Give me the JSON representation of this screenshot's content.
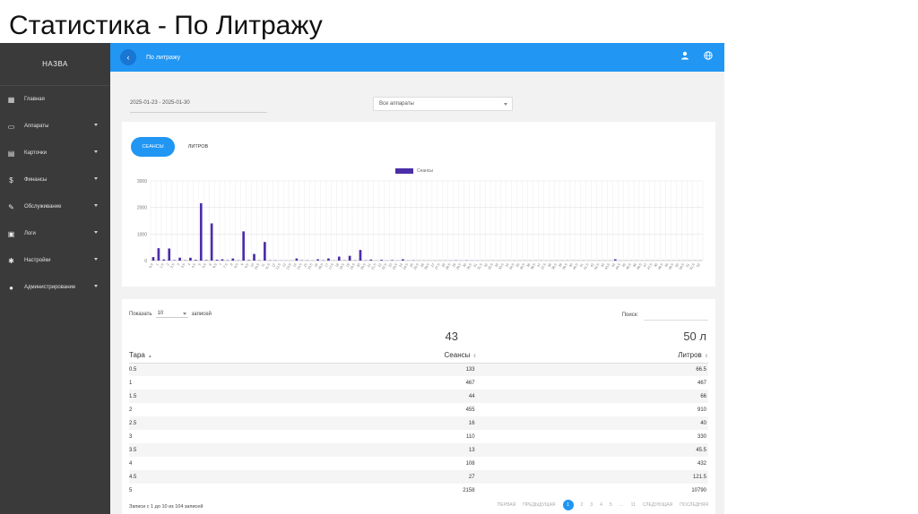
{
  "slide_title": "Статистика - По Литражу",
  "sidebar": {
    "brand": "НАЗВА",
    "items": [
      {
        "label": "Главная",
        "icon": "dashboard-icon",
        "caret": false
      },
      {
        "label": "Аппараты",
        "icon": "devices-icon",
        "caret": true
      },
      {
        "label": "Карточки",
        "icon": "card-icon",
        "caret": true
      },
      {
        "label": "Финансы",
        "icon": "money-icon",
        "caret": true
      },
      {
        "label": "Обслуживание",
        "icon": "wrench-icon",
        "caret": true
      },
      {
        "label": "Логи",
        "icon": "log-icon",
        "caret": true
      },
      {
        "label": "Настройки",
        "icon": "gear-icon",
        "caret": true
      },
      {
        "label": "Администрирование",
        "icon": "person-icon",
        "caret": true
      }
    ]
  },
  "topbar": {
    "title": "По литражу",
    "back_icon": "chevron-left-icon",
    "icons": [
      "user-icon",
      "globe-icon"
    ],
    "color": "#2196f3"
  },
  "filters": {
    "date_range": "2025-01-23 - 2025-01-30",
    "device_select": "Все аппараты"
  },
  "tabs": {
    "sessions": "СЕАНСЫ",
    "liters": "ЛИТРОВ"
  },
  "chart_data": {
    "type": "bar",
    "legend": [
      "Сеансы"
    ],
    "bar_color": "#4b2ea8",
    "ylim": [
      0,
      3000
    ],
    "yticks": [
      "0",
      "1000",
      "2000",
      "3000"
    ],
    "grid": true,
    "categories": [
      "0.5",
      "1",
      "1.5",
      "2",
      "2.5",
      "3",
      "3.5",
      "4",
      "4.5",
      "5",
      "5.5",
      "6",
      "6.5",
      "7",
      "7.5",
      "8",
      "8.5",
      "9",
      "9.5",
      "10",
      "10.5",
      "11",
      "11.5",
      "12",
      "12.5",
      "13",
      "13.5",
      "14",
      "14.5",
      "15",
      "15.5",
      "16",
      "16.5",
      "17",
      "17.5",
      "18",
      "18.5",
      "19",
      "19.5",
      "20",
      "20.5",
      "21",
      "21.5",
      "22",
      "22.5",
      "23",
      "23.5",
      "24",
      "24.5",
      "25",
      "25.5",
      "26",
      "26.5",
      "27",
      "27.5",
      "28",
      "28.5",
      "29",
      "29.5",
      "30",
      "30.5",
      "31",
      "31.5",
      "32",
      "32.5",
      "33",
      "33.5",
      "34",
      "34.5",
      "35",
      "35.5",
      "36",
      "36.5",
      "37",
      "37.5",
      "38",
      "38.5",
      "39",
      "39.5",
      "40",
      "40.5",
      "41",
      "41.5",
      "42",
      "42.5",
      "43",
      "43.5",
      "44",
      "44.5",
      "45",
      "45.5",
      "46",
      "46.5",
      "47",
      "47.5",
      "48",
      "48.5",
      "49",
      "49.5",
      "50",
      "50.5",
      "51",
      "51.5",
      "52"
    ],
    "values": [
      133,
      467,
      44,
      455,
      16,
      110,
      13,
      108,
      27,
      2158,
      20,
      1400,
      30,
      50,
      15,
      80,
      10,
      1100,
      20,
      250,
      10,
      700,
      10,
      10,
      5,
      5,
      5,
      80,
      10,
      10,
      5,
      50,
      10,
      80,
      5,
      150,
      10,
      180,
      10,
      400,
      10,
      40,
      5,
      30,
      5,
      20,
      5,
      50,
      5,
      10,
      5,
      5,
      5,
      5,
      5,
      5,
      5,
      10,
      5,
      10,
      5,
      5,
      5,
      5,
      5,
      5,
      5,
      5,
      5,
      5,
      5,
      5,
      5,
      5,
      5,
      5,
      5,
      5,
      5,
      5,
      5,
      5,
      5,
      5,
      5,
      5,
      5,
      50,
      5,
      5,
      5,
      5,
      5,
      5,
      5,
      5,
      5,
      5,
      5,
      5,
      5,
      5,
      5,
      5
    ]
  },
  "table": {
    "show_label": "Показать",
    "show_value": "10",
    "show_suffix": "записей",
    "search_label": "Поиск:",
    "search_value": "",
    "total_sessions": "43",
    "total_liters": "50 л",
    "headers": {
      "tara": "Тара",
      "sessions": "Сеансы",
      "liters": "Литров"
    },
    "rows": [
      {
        "tara": "0.5",
        "sessions": "133",
        "liters": "66.5"
      },
      {
        "tara": "1",
        "sessions": "467",
        "liters": "467"
      },
      {
        "tara": "1.5",
        "sessions": "44",
        "liters": "66"
      },
      {
        "tara": "2",
        "sessions": "455",
        "liters": "910"
      },
      {
        "tara": "2.5",
        "sessions": "16",
        "liters": "40"
      },
      {
        "tara": "3",
        "sessions": "110",
        "liters": "330"
      },
      {
        "tara": "3.5",
        "sessions": "13",
        "liters": "45.5"
      },
      {
        "tara": "4",
        "sessions": "108",
        "liters": "432"
      },
      {
        "tara": "4.5",
        "sessions": "27",
        "liters": "121.5"
      },
      {
        "tara": "5",
        "sessions": "2158",
        "liters": "10790"
      }
    ],
    "footer_info": "Записи с 1 до 10 из 104 записей",
    "pager": {
      "first": "ПЕРВАЯ",
      "prev": "ПРЕДЫДУЩАЯ",
      "pages": [
        "1",
        "2",
        "3",
        "4",
        "5",
        "…",
        "11"
      ],
      "active_page": "1",
      "next": "СЛЕДУЮЩАЯ",
      "last": "ПОСЛЕДНЯЯ"
    }
  }
}
